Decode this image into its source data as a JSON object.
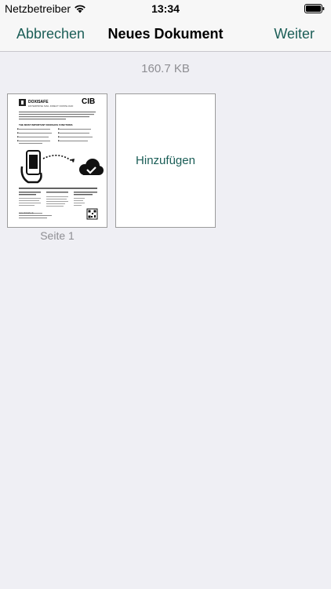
{
  "status_bar": {
    "carrier": "Netzbetreiber",
    "time": "13:34"
  },
  "nav": {
    "cancel_label": "Abbrechen",
    "title": "Neues Dokument",
    "next_label": "Weiter"
  },
  "document": {
    "file_size": "160.7 KB",
    "pages": [
      {
        "label": "Seite 1",
        "preview": {
          "logo_name": "DOXISAFE",
          "subtitle": "ENTERPRISE MAIL DIRECT DOWNLOAD",
          "brand": "CIB",
          "section_heading": "THE MOST IMPORTANT DOXISAFE FUNCTIONS",
          "footer": "www.doxisafe.de"
        }
      }
    ],
    "add_label": "Hinzufügen"
  },
  "colors": {
    "accent": "#1b5e57",
    "background": "#efeff4",
    "bar": "#f7f7f7",
    "secondary_text": "#8e8e93"
  }
}
